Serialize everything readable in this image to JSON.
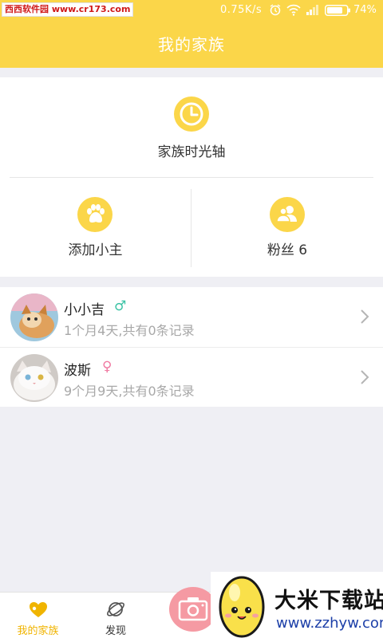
{
  "status_bar": {
    "watermark": "西西软件园 www.cr173.com",
    "net_speed": "0.75K/s",
    "battery": "74%"
  },
  "nav": {
    "title": "我的家族"
  },
  "family": {
    "timeline_label": "家族时光轴",
    "add_owner_label": "添加小主",
    "fans_label": "粉丝 6"
  },
  "pets": [
    {
      "name": "小小吉",
      "gender": "♂",
      "gender_color": "#3cc3a5",
      "summary": "1个月4天,共有0条记录"
    },
    {
      "name": "波斯",
      "gender": "♀",
      "gender_color": "#f07aa2",
      "summary": "9个月9天,共有0条记录"
    }
  ],
  "tabs": {
    "family": "我的家族",
    "discover": "发现"
  },
  "watermark_bottom": {
    "brand": "大米下载站",
    "url": "www.zzhyw.com"
  },
  "colors": {
    "accent": "#fbd649",
    "active_tab": "#f0b400",
    "camera": "#f59aa3"
  }
}
